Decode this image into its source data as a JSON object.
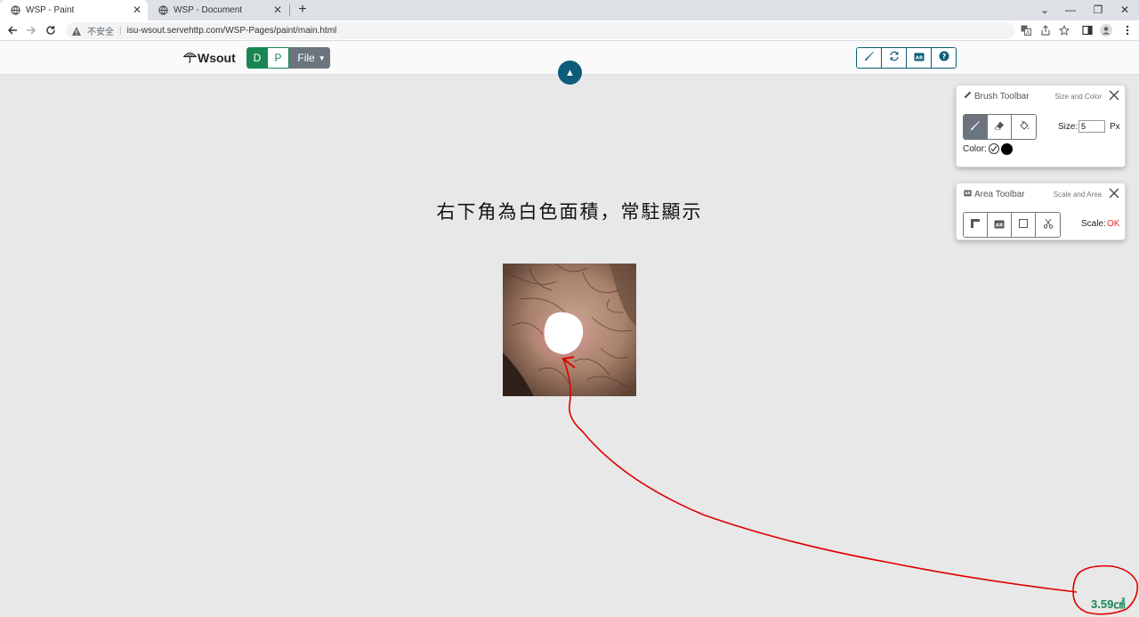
{
  "browser": {
    "tabs": [
      {
        "title": "WSP - Paint",
        "active": true
      },
      {
        "title": "WSP - Document",
        "active": false
      }
    ],
    "address": {
      "security": "不安全",
      "url": "isu-wsout.servehttp.com/WSP-Pages/paint/main.html"
    }
  },
  "navbar": {
    "brand": "Wsout",
    "mode_d": "D",
    "mode_p": "P",
    "file_label": "File",
    "toggle_symbol": "▲"
  },
  "canvas": {
    "heading": "右下角為白色面積，常駐顯示",
    "area_result": "3.59㎠"
  },
  "brush_toolbar": {
    "title": "Brush Toolbar",
    "subtitle": "Size and Color",
    "size_label": "Size:",
    "size_value": "5",
    "size_unit": "Px",
    "color_label": "Color:",
    "color_value": "#000000"
  },
  "area_toolbar": {
    "title": "Area Toolbar",
    "subtitle": "Scale and Area",
    "scale_label": "Scale:",
    "scale_status": "OK"
  },
  "colors": {
    "primary_teal": "#0d5c7a",
    "success_green": "#198754",
    "secondary_gray": "#6c757d",
    "status_red": "#e8282b",
    "annotation_red": "#e00000"
  }
}
